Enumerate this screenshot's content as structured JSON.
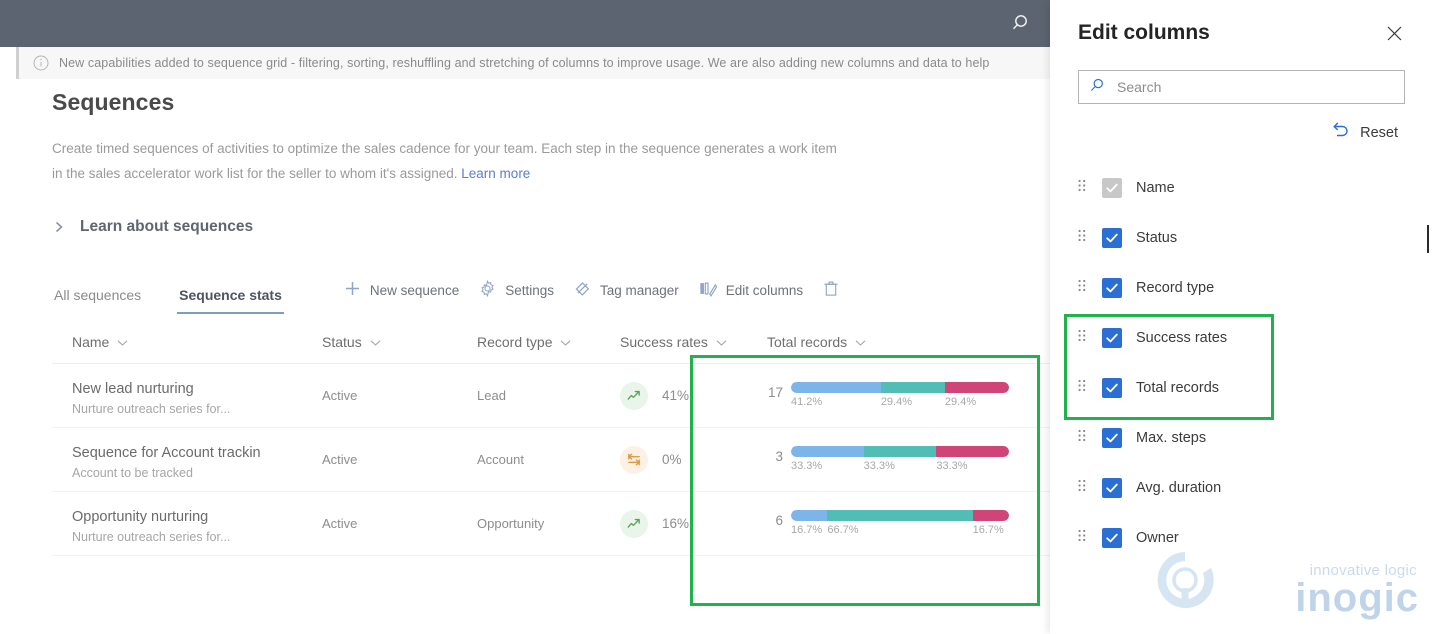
{
  "topbar": {
    "search_icon": "search-icon"
  },
  "notification": {
    "icon": "info-icon",
    "text": "New capabilities added to sequence grid - filtering, sorting, reshuffling and stretching of columns to improve usage. We are also adding new columns and data to help"
  },
  "page": {
    "title": "Sequences",
    "description": "Create timed sequences of activities to optimize the sales cadence for your team. Each step in the sequence generates a work item in the sales accelerator work list for the seller to whom it's assigned.",
    "learn_more": "Learn more",
    "expander_label": "Learn about sequences"
  },
  "tabs": [
    {
      "label": "All sequences",
      "active": false
    },
    {
      "label": "Sequence stats",
      "active": true
    }
  ],
  "commands": [
    {
      "label": "New sequence",
      "icon": "plus-icon"
    },
    {
      "label": "Settings",
      "icon": "gear-icon"
    },
    {
      "label": "Tag manager",
      "icon": "tag-icon"
    },
    {
      "label": "Edit columns",
      "icon": "columns-icon"
    }
  ],
  "grid": {
    "columns": [
      {
        "label": "Name",
        "sort_icon": "chevron-down-icon"
      },
      {
        "label": "Status",
        "sort_icon": "chevron-down-icon"
      },
      {
        "label": "Record type",
        "sort_icon": "chevron-down-icon"
      },
      {
        "label": "Success rates",
        "sort_icon": "chevron-down-icon"
      },
      {
        "label": "Total records",
        "sort_icon": "chevron-down-icon"
      }
    ],
    "rows": [
      {
        "name": "New lead nurturing",
        "subtitle": "Nurture outreach series for...",
        "status": "Active",
        "record_type": "Lead",
        "success_rate": "41%",
        "trend_icon": "trend-up-icon",
        "trend": "up",
        "total_records": "17",
        "segments": [
          {
            "label": "41.2%",
            "value": 41.2,
            "color": "#7eb5e8"
          },
          {
            "label": "29.4%",
            "value": 29.4,
            "color": "#52bdb4"
          },
          {
            "label": "29.4%",
            "value": 29.4,
            "color": "#cf4578"
          }
        ]
      },
      {
        "name": "Sequence for Account trackin",
        "subtitle": "Account to be tracked",
        "status": "Active",
        "record_type": "Account",
        "success_rate": "0%",
        "trend_icon": "trend-flat-icon",
        "trend": "flat",
        "total_records": "3",
        "segments": [
          {
            "label": "33.3%",
            "value": 33.3,
            "color": "#7eb5e8"
          },
          {
            "label": "33.3%",
            "value": 33.3,
            "color": "#52bdb4"
          },
          {
            "label": "33.3%",
            "value": 33.3,
            "color": "#cf4578"
          }
        ]
      },
      {
        "name": "Opportunity nurturing",
        "subtitle": "Nurture outreach series for...",
        "status": "Active",
        "record_type": "Opportunity",
        "success_rate": "16%",
        "trend_icon": "trend-up-icon",
        "trend": "up",
        "total_records": "6",
        "segments": [
          {
            "label": "16.7%",
            "value": 16.7,
            "color": "#7eb5e8"
          },
          {
            "label": "66.7%",
            "value": 66.7,
            "color": "#52bdb4"
          },
          {
            "label": "16.7%",
            "value": 16.7,
            "color": "#cf4578"
          }
        ]
      }
    ]
  },
  "panel": {
    "title": "Edit columns",
    "close_icon": "close-icon",
    "search": {
      "placeholder": "Search",
      "value": "",
      "icon": "search-icon"
    },
    "reset": {
      "label": "Reset",
      "icon": "undo-icon"
    },
    "items": [
      {
        "label": "Name",
        "checked": true,
        "locked": true,
        "highlighted": false
      },
      {
        "label": "Status",
        "checked": true,
        "locked": false,
        "highlighted": false
      },
      {
        "label": "Record type",
        "checked": true,
        "locked": false,
        "highlighted": false
      },
      {
        "label": "Success rates",
        "checked": true,
        "locked": false,
        "highlighted": true
      },
      {
        "label": "Total records",
        "checked": true,
        "locked": false,
        "highlighted": true
      },
      {
        "label": "Max. steps",
        "checked": true,
        "locked": false,
        "highlighted": false
      },
      {
        "label": "Avg. duration",
        "checked": true,
        "locked": false,
        "highlighted": false
      },
      {
        "label": "Owner",
        "checked": true,
        "locked": false,
        "highlighted": false
      }
    ]
  },
  "highlight_color": "#22b14c",
  "watermark": {
    "tagline": "innovative logic",
    "brand": "inogic"
  }
}
